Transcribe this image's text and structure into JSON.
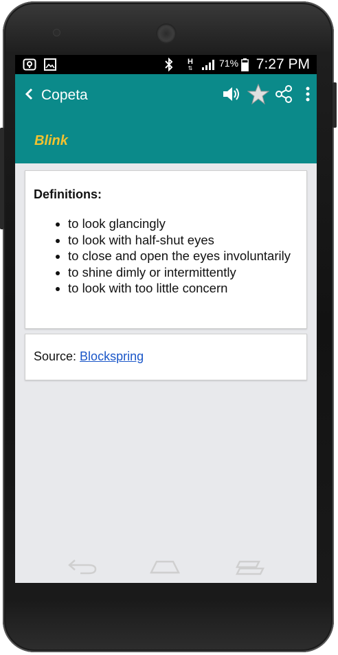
{
  "status_bar": {
    "battery_percent": "71%",
    "time": "7:27 PM",
    "network_label": "H"
  },
  "app_bar": {
    "title": "Copeta",
    "word": "Blink",
    "colors": {
      "toolbar": "#0b8a8a",
      "word": "#f2c230"
    }
  },
  "definitions": {
    "heading": "Definitions:",
    "items": [
      "to look glancingly",
      "to look with half-shut eyes",
      "to close and open the eyes involuntarily",
      "to shine dimly or intermittently",
      "to look with too little concern"
    ]
  },
  "source": {
    "label": "Source: ",
    "link_text": "Blockspring"
  },
  "icons": {
    "back": "back-arrow-icon",
    "speaker": "speaker-icon",
    "favorite": "star-icon",
    "share": "share-icon",
    "more": "more-vert-icon"
  }
}
